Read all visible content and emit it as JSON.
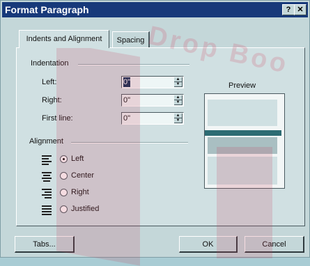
{
  "window": {
    "title": "Format Paragraph",
    "help_btn": "?",
    "close_btn": "✕"
  },
  "tabs": [
    {
      "label": "Indents and Alignment"
    },
    {
      "label": "Spacing"
    }
  ],
  "indentation": {
    "heading": "Indentation",
    "left": {
      "label": "Left:",
      "value": "0\""
    },
    "right": {
      "label": "Right:",
      "value": "0\""
    },
    "first_line": {
      "label": "First line:",
      "value": "0\""
    }
  },
  "alignment": {
    "heading": "Alignment",
    "options": [
      {
        "label": "Left",
        "checked": true,
        "icon": "align-left-icon"
      },
      {
        "label": "Center",
        "checked": false,
        "icon": "align-center-icon"
      },
      {
        "label": "Right",
        "checked": false,
        "icon": "align-right-icon"
      },
      {
        "label": "Justified",
        "checked": false,
        "icon": "align-justify-icon"
      }
    ]
  },
  "preview": {
    "label": "Preview"
  },
  "buttons": {
    "tabs": "Tabs...",
    "ok": "OK",
    "cancel": "Cancel"
  },
  "watermark": {
    "text": "Drop Boo"
  },
  "colors": {
    "titlebar": "#17397a",
    "dialog": "#c4d7d9",
    "accent": "#2d6c73"
  }
}
